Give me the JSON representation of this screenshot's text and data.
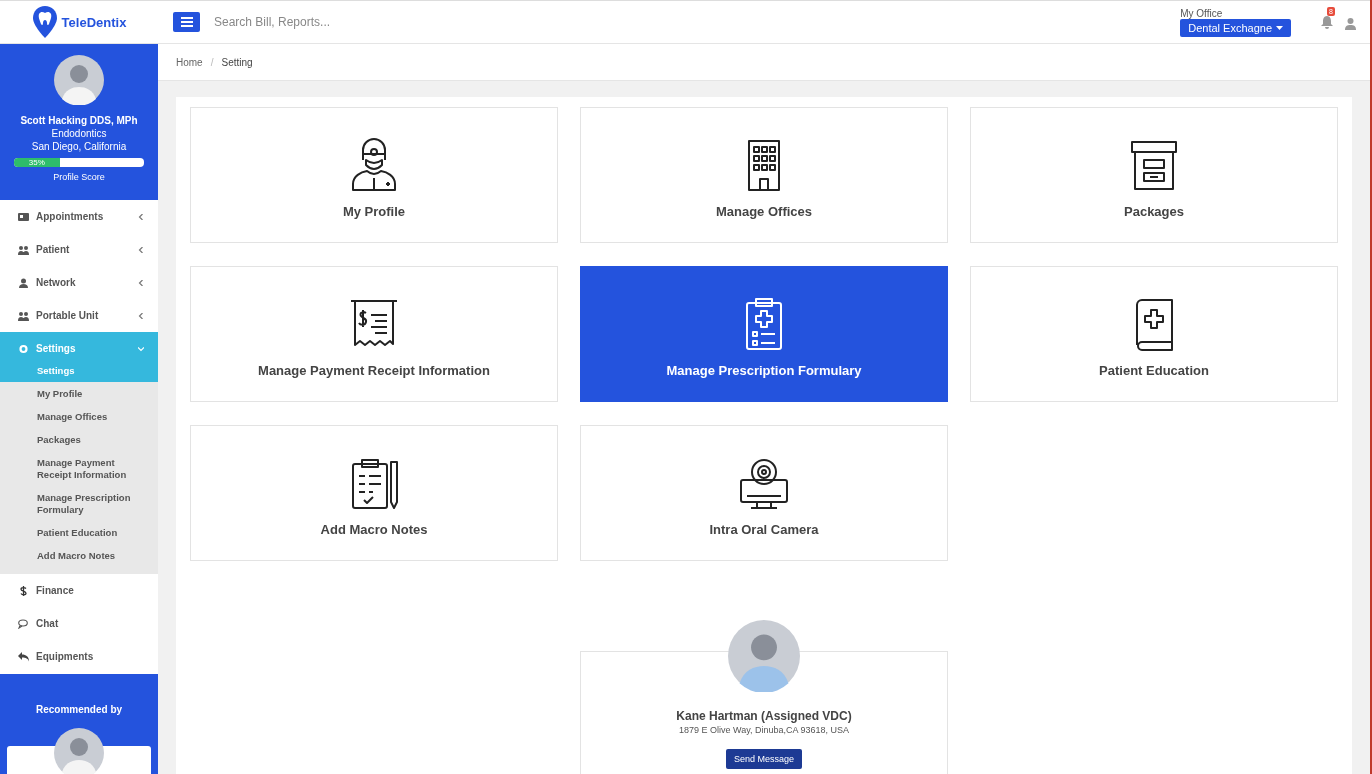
{
  "header": {
    "logo": "TeleDentix",
    "search": {
      "placeholder": "Search Bill, Reports..."
    },
    "office_label": "My Office",
    "office_button": "Dental Exchagne",
    "notification_count": "8"
  },
  "profile": {
    "name": "Scott Hacking DDS, MPh",
    "specialty": "Endodontics",
    "location": "San Diego, California",
    "score": {
      "level": 0.35,
      "reading": "35%",
      "label": "Profile Score"
    }
  },
  "menu": [
    {
      "kind": "group",
      "label": "Appointments",
      "expanded": false,
      "selected": false
    },
    {
      "kind": "group",
      "label": "Patient",
      "expanded": false,
      "selected": false
    },
    {
      "kind": "group",
      "label": "Network",
      "expanded": false,
      "selected": false
    },
    {
      "kind": "group",
      "label": "Portable Unit",
      "expanded": false,
      "selected": false
    },
    {
      "kind": "group",
      "label": "Settings",
      "expanded": true,
      "selected": true,
      "children": [
        {
          "label": "Settings",
          "selected": true
        },
        {
          "label": "My Profile",
          "selected": false
        },
        {
          "label": "Manage Offices",
          "selected": false
        },
        {
          "label": "Packages",
          "selected": false
        },
        {
          "label": "Manage Payment Receipt Information",
          "selected": false
        },
        {
          "label": "Manage Prescription Formulary",
          "selected": false
        },
        {
          "label": "Patient Education",
          "selected": false
        },
        {
          "label": "Add Macro Notes",
          "selected": false
        }
      ]
    },
    {
      "kind": "link",
      "label": "Finance",
      "selected": false
    },
    {
      "kind": "link",
      "label": "Chat",
      "selected": false
    },
    {
      "kind": "link",
      "label": "Equipments",
      "selected": false
    }
  ],
  "recommended_by": "Recommended by",
  "breadcrumb": [
    "Home",
    "Setting"
  ],
  "breadcrumb_separator": "/",
  "tiles": [
    {
      "label": "My Profile",
      "selected": false
    },
    {
      "label": "Manage Offices",
      "selected": false
    },
    {
      "label": "Packages",
      "selected": false
    },
    {
      "label": "Manage Payment Receipt Information",
      "selected": false
    },
    {
      "label": "Manage Prescription Formulary",
      "selected": true
    },
    {
      "label": "Patient Education",
      "selected": false
    },
    {
      "label": "Add Macro Notes",
      "selected": false
    },
    {
      "label": "Intra Oral Camera",
      "selected": false
    }
  ],
  "vdc": {
    "name": "Kane Hartman (Assigned VDC)",
    "address": "1879 E Olive Way, Dinuba,CA 93618, USA",
    "button": "Send Message"
  }
}
